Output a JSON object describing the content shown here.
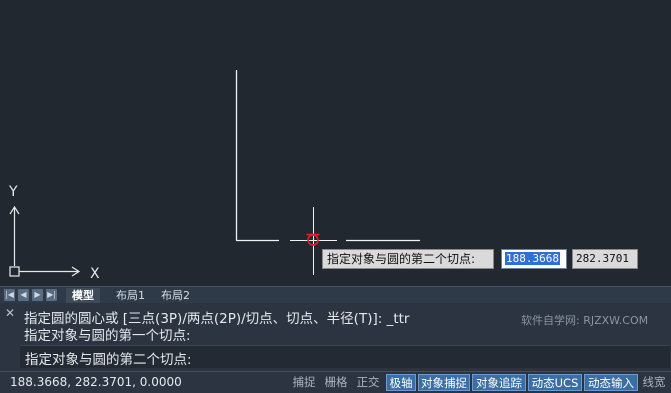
{
  "canvas": {
    "axis_y_label": "Y",
    "axis_x_label": "X",
    "dynamic_prompt": "指定对象与圆的第二个切点:",
    "input_x": "188.3668",
    "input_y": "282.3701"
  },
  "tabs": [
    {
      "label": "模型",
      "active": true
    },
    {
      "label": "布局1",
      "active": false
    },
    {
      "label": "布局2",
      "active": false
    }
  ],
  "command": {
    "history": [
      "指定圆的圆心或 [三点(3P)/两点(2P)/切点、切点、半径(T)]: _ttr",
      "指定对象与圆的第一个切点:"
    ],
    "current": "指定对象与圆的第二个切点:",
    "watermark": "软件自学网: RJZXW.COM"
  },
  "status": {
    "coords": "188.3668, 282.3701, 0.0000",
    "buttons": [
      {
        "label": "捕捉",
        "on": false
      },
      {
        "label": "栅格",
        "on": false
      },
      {
        "label": "正交",
        "on": false
      },
      {
        "label": "极轴",
        "on": true
      },
      {
        "label": "对象捕捉",
        "on": true
      },
      {
        "label": "对象追踪",
        "on": true
      },
      {
        "label": "动态UCS",
        "on": true
      },
      {
        "label": "动态输入",
        "on": true
      },
      {
        "label": "线宽",
        "on": false
      }
    ]
  },
  "colors": {
    "canvas_bg": "#212830",
    "cursor_marker": "#e0202a",
    "toggle_on": "#3b6ea3"
  }
}
